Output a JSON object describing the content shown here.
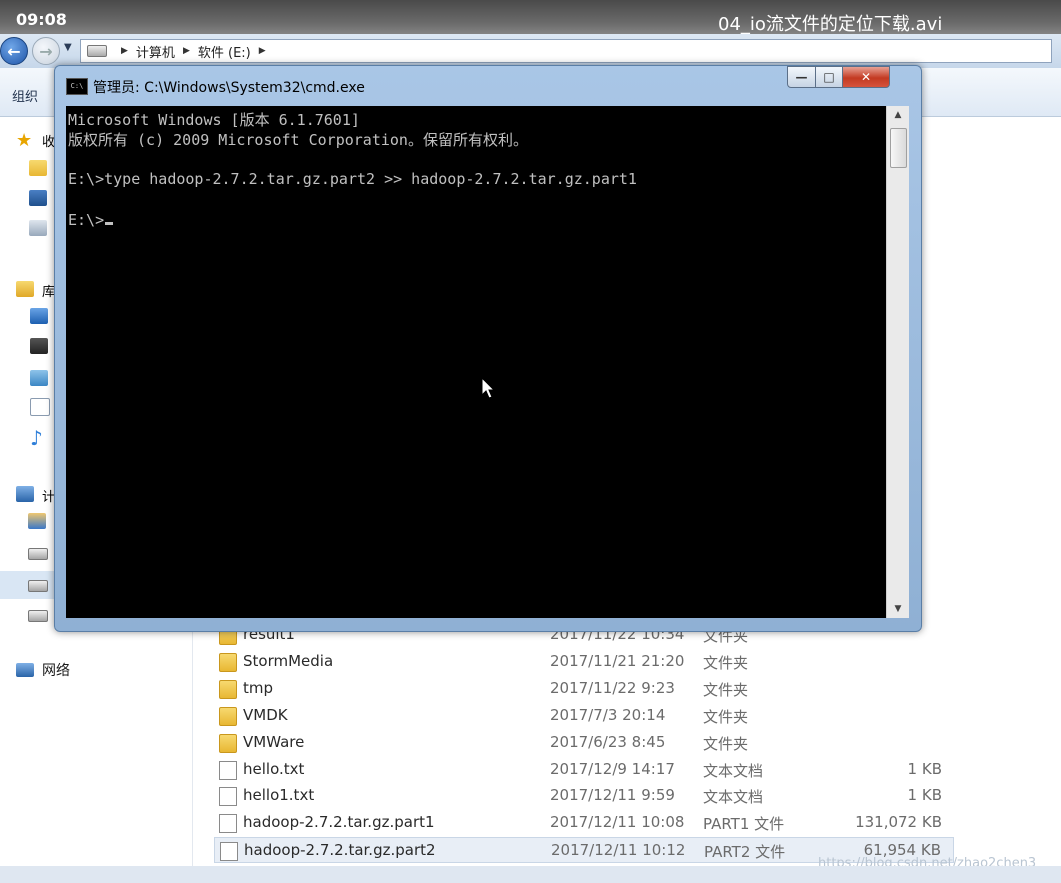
{
  "overlay": {
    "time": "09:08",
    "video_title": "04_io流文件的定位下载.avi"
  },
  "explorer": {
    "address": [
      "计算机",
      "软件 (E:)"
    ],
    "toolbar": {
      "organize_label": "组织"
    },
    "nav": {
      "favorites_label": "收",
      "libraries_label": "库",
      "computer_label": "计",
      "network_label": "网络"
    },
    "files": [
      {
        "name": "result1",
        "date": "2017/11/22 10:34",
        "type": "文件夹",
        "size": "",
        "icon": "folder-icon"
      },
      {
        "name": "StormMedia",
        "date": "2017/11/21 21:20",
        "type": "文件夹",
        "size": "",
        "icon": "folder-icon"
      },
      {
        "name": "tmp",
        "date": "2017/11/22 9:23",
        "type": "文件夹",
        "size": "",
        "icon": "folder-icon"
      },
      {
        "name": "VMDK",
        "date": "2017/7/3 20:14",
        "type": "文件夹",
        "size": "",
        "icon": "folder-icon"
      },
      {
        "name": "VMWare",
        "date": "2017/6/23 8:45",
        "type": "文件夹",
        "size": "",
        "icon": "folder-icon"
      },
      {
        "name": "hello.txt",
        "date": "2017/12/9 14:17",
        "type": "文本文档",
        "size": "1 KB",
        "icon": "text-file-icon"
      },
      {
        "name": "hello1.txt",
        "date": "2017/12/11 9:59",
        "type": "文本文档",
        "size": "1 KB",
        "icon": "text-file-icon"
      },
      {
        "name": "hadoop-2.7.2.tar.gz.part1",
        "date": "2017/12/11 10:08",
        "type": "PART1 文件",
        "size": "131,072 KB",
        "icon": "file-icon"
      },
      {
        "name": "hadoop-2.7.2.tar.gz.part2",
        "date": "2017/12/11 10:12",
        "type": "PART2 文件",
        "size": "61,954 KB",
        "icon": "file-icon"
      }
    ],
    "watermark": "https://blog.csdn.net/zhao2chen3"
  },
  "cmd": {
    "title": "管理员: C:\\Windows\\System32\\cmd.exe",
    "app_icon_text": "C:\\",
    "buttons": {
      "minimize": "—",
      "maximize": "□",
      "close": "✕"
    },
    "lines": [
      "Microsoft Windows [版本 6.1.7601]",
      "版权所有 (c) 2009 Microsoft Corporation。保留所有权利。",
      "",
      "E:\\>type hadoop-2.7.2.tar.gz.part2 >> hadoop-2.7.2.tar.gz.part1",
      "",
      "E:\\>"
    ],
    "scroll": {
      "up": "▲",
      "down": "▼"
    }
  }
}
